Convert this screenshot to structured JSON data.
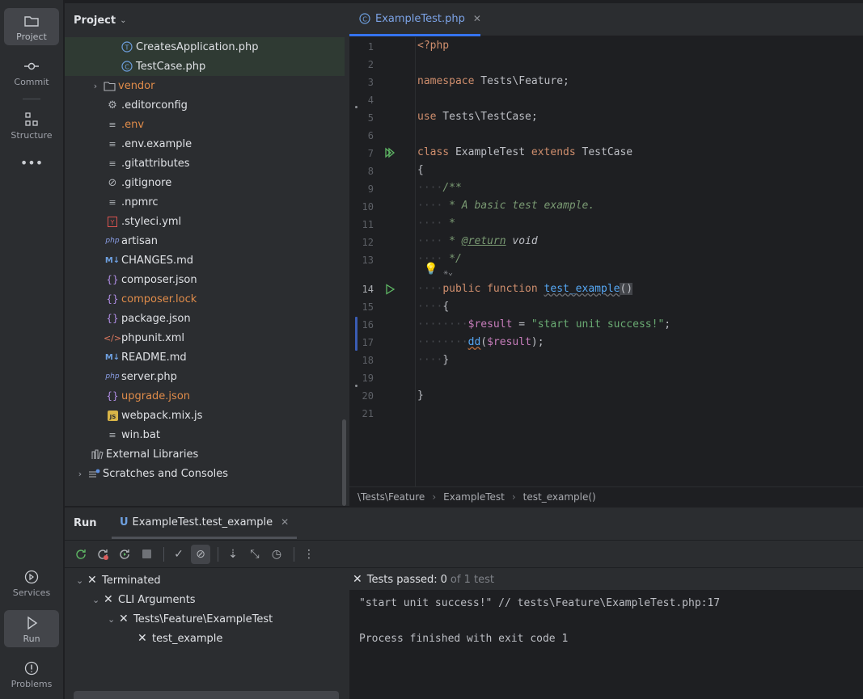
{
  "sidebar": {
    "project": "Project",
    "commit": "Commit",
    "structure": "Structure",
    "more": "•••",
    "services": "Services",
    "run": "Run",
    "problems": "Problems"
  },
  "project_panel": {
    "title": "Project",
    "items": [
      {
        "label": "CreatesApplication.php",
        "icon": "php-interface-icon"
      },
      {
        "label": "TestCase.php",
        "icon": "php-class-icon"
      },
      {
        "label": "vendor",
        "icon": "folder-icon"
      },
      {
        "label": ".editorconfig",
        "icon": "gear-file-icon"
      },
      {
        "label": ".env",
        "icon": "text-file-icon"
      },
      {
        "label": ".env.example",
        "icon": "text-file-icon"
      },
      {
        "label": ".gitattributes",
        "icon": "text-file-icon"
      },
      {
        "label": ".gitignore",
        "icon": "ignore-file-icon"
      },
      {
        "label": ".npmrc",
        "icon": "text-file-icon"
      },
      {
        "label": ".styleci.yml",
        "icon": "yaml-file-icon"
      },
      {
        "label": "artisan",
        "icon": "php-file-icon"
      },
      {
        "label": "CHANGES.md",
        "icon": "markdown-icon"
      },
      {
        "label": "composer.json",
        "icon": "json-icon"
      },
      {
        "label": "composer.lock",
        "icon": "json-icon"
      },
      {
        "label": "package.json",
        "icon": "json-icon"
      },
      {
        "label": "phpunit.xml",
        "icon": "xml-icon"
      },
      {
        "label": "README.md",
        "icon": "markdown-icon"
      },
      {
        "label": "server.php",
        "icon": "php-file-icon"
      },
      {
        "label": "upgrade.json",
        "icon": "json-icon"
      },
      {
        "label": "webpack.mix.js",
        "icon": "js-icon"
      },
      {
        "label": "win.bat",
        "icon": "text-file-icon"
      },
      {
        "label": "External Libraries",
        "icon": "library-icon"
      },
      {
        "label": "Scratches and Consoles",
        "icon": "scratches-icon"
      }
    ]
  },
  "editor": {
    "tab": "ExampleTest.php",
    "line_numbers": [
      "1",
      "2",
      "3",
      "4",
      "5",
      "6",
      "7",
      "8",
      "9",
      "10",
      "11",
      "12",
      "13",
      "14",
      "15",
      "16",
      "17",
      "18",
      "19",
      "20",
      "21"
    ],
    "code": {
      "l1": "<?php",
      "l3_kw": "namespace",
      "l3_rest": " Tests\\Feature;",
      "l5_kw": "use",
      "l5_rest": " Tests\\TestCase;",
      "l7_kw1": "class",
      "l7_name": " ExampleTest ",
      "l7_kw2": "extends",
      "l7_rest": " TestCase",
      "l8": "{",
      "l9": "/**",
      "l10": " * A basic test example.",
      "l11": " *",
      "l12_a": " * ",
      "l12_tag": "@return",
      "l12_b": " void",
      "l13": " */",
      "l14_kw": "public function",
      "l14_fn": "test_example",
      "l14_rest": "()",
      "l15": "{",
      "l16_var": "$result",
      "l16_eq": " = ",
      "l16_str": "\"start unit success!\"",
      "l16_end": ";",
      "l17_fn": "dd",
      "l17_a": "(",
      "l17_var": "$result",
      "l17_b": ");",
      "l18": "}",
      "l20": "}"
    },
    "breadcrumb": [
      "\\Tests\\Feature",
      "ExampleTest",
      "test_example()"
    ]
  },
  "run_panel": {
    "title": "Run",
    "tab": "ExampleTest.test_example",
    "tree": [
      "Terminated",
      "CLI Arguments",
      "Tests\\Feature\\ExampleTest",
      "test_example"
    ],
    "status_label": "Tests passed:",
    "status_count": "0",
    "status_total": "of 1 test",
    "console": [
      "\"start unit success!\" // tests\\Feature\\ExampleTest.php:17",
      "Process finished with exit code 1"
    ]
  }
}
